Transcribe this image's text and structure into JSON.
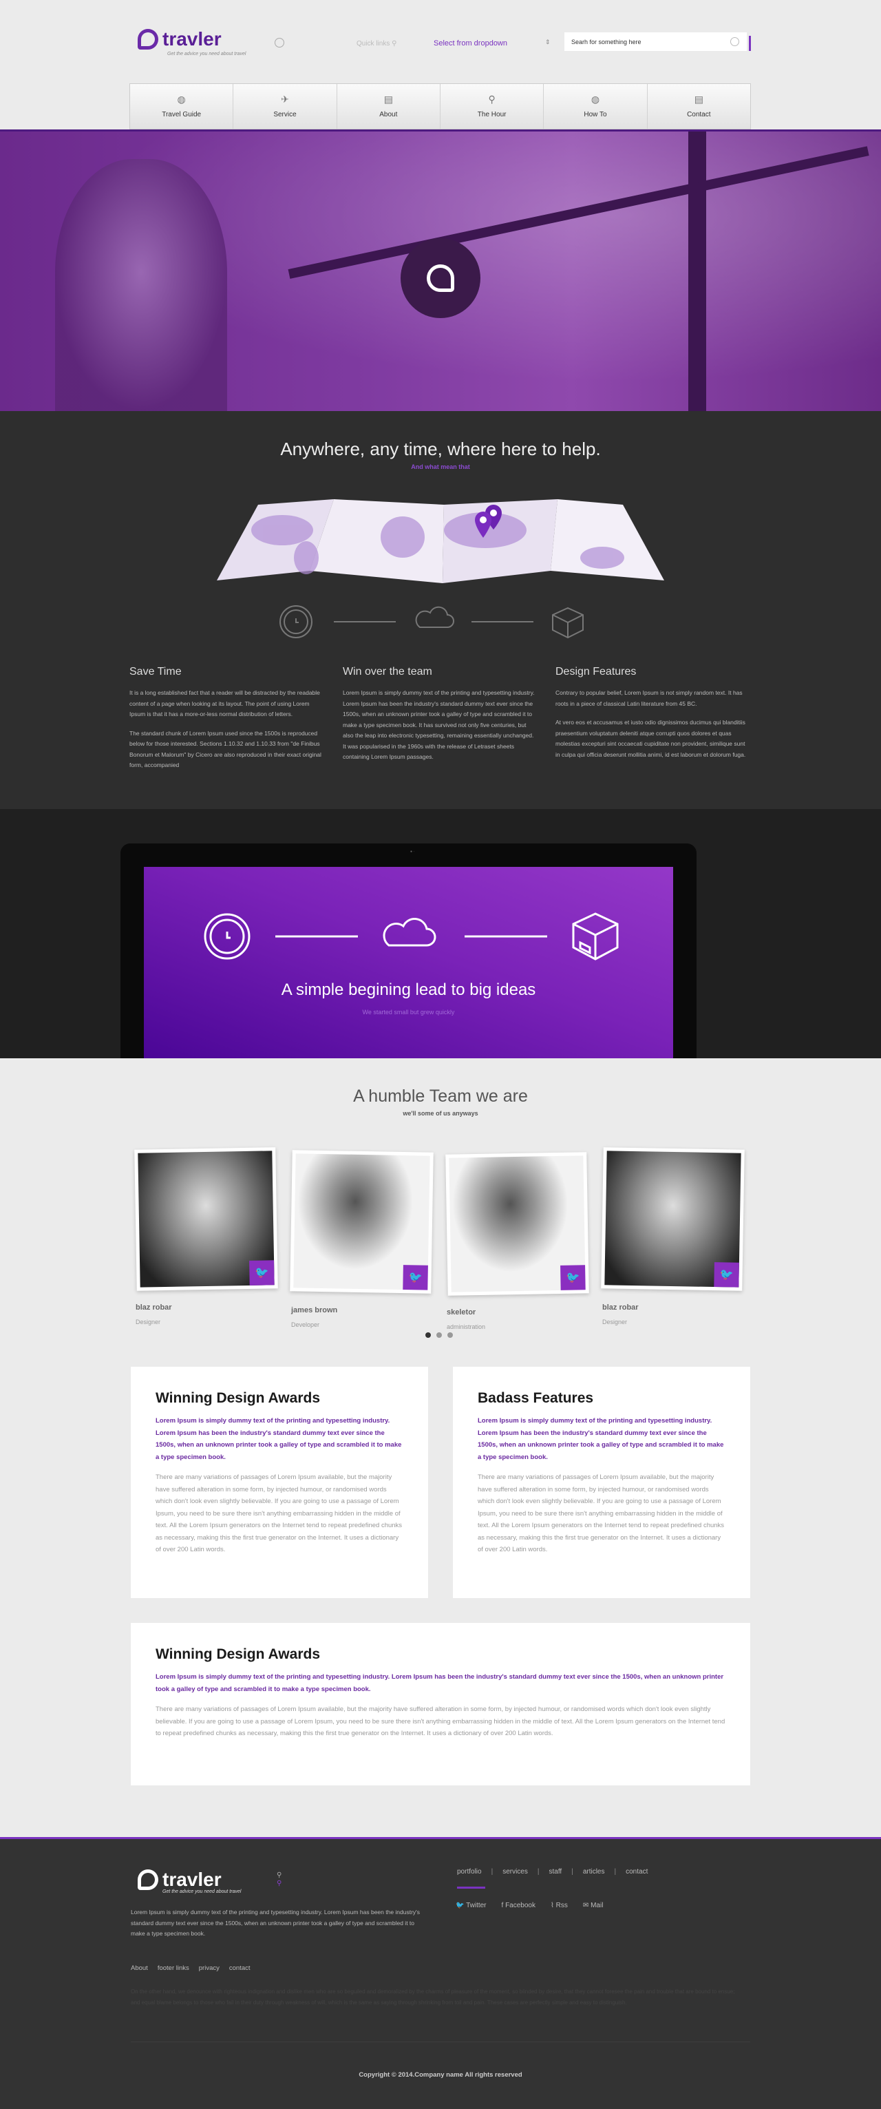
{
  "header": {
    "logo_text": "travler",
    "tagline": "Get the advice you need about travel",
    "quick_links": "Quick links",
    "dropdown_selected": "Select from dropdown",
    "search_placeholder": "Searh for something here"
  },
  "nav": [
    {
      "label": "Travel Guide",
      "icon": "globe-icon"
    },
    {
      "label": "Service",
      "icon": "paper-plane-icon"
    },
    {
      "label": "About",
      "icon": "document-icon"
    },
    {
      "label": "The Hour",
      "icon": "map-pin-icon"
    },
    {
      "label": "How To",
      "icon": "globe-icon"
    },
    {
      "label": "Contact",
      "icon": "document-icon"
    }
  ],
  "colors": {
    "accent": "#7a33c0",
    "dark": "#2e2e2e",
    "light": "#ebebeb"
  },
  "help": {
    "title": "Anywhere, any time, where here to help.",
    "subtitle": "And what mean that",
    "columns": [
      {
        "heading": "Save Time",
        "paragraphs": [
          "It is a long established fact that a reader will be distracted by the readable content of a page when looking at its layout. The point of using Lorem Ipsum is that it has a more-or-less normal distribution of letters.",
          "The standard chunk of Lorem Ipsum used since the 1500s is reproduced below for those interested. Sections 1.10.32 and 1.10.33 from \"de Finibus Bonorum et Malorum\" by Cicero are also reproduced in their exact original form, accompanied"
        ]
      },
      {
        "heading": "Win over the team",
        "paragraphs": [
          "Lorem Ipsum is simply dummy text of the printing and typesetting industry. Lorem Ipsum has been the industry's standard dummy text ever since the 1500s, when an unknown printer took a galley of type and scrambled it to make a type specimen book. It has survived not only five centuries, but also the leap into electronic typesetting, remaining essentially unchanged. It was popularised in the 1960s with the release of Letraset sheets containing Lorem Ipsum passages."
        ]
      },
      {
        "heading": "Design Features",
        "paragraphs": [
          "Contrary to popular belief, Lorem Ipsum is not simply random text. It has roots in a piece of classical Latin literature from 45 BC.",
          "At vero eos et accusamus et iusto odio dignissimos ducimus qui blanditiis praesentium voluptatum deleniti atque corrupti quos dolores et quas molestias excepturi sint occaecati cupiditate non provident, similique sunt in culpa qui officia deserunt mollitia animi, id est laborum et dolorum fuga."
        ]
      }
    ]
  },
  "ideas": {
    "title": "A simple begining lead to big ideas",
    "subtitle": "We started small but grew quickly"
  },
  "team": {
    "title": "A humble Team we are",
    "subtitle": "we'll some of us anyways",
    "members": [
      {
        "name": "blaz robar",
        "role": "Designer"
      },
      {
        "name": "james brown",
        "role": "Developer"
      },
      {
        "name": "skeletor",
        "role": "administration"
      },
      {
        "name": "blaz robar",
        "role": "Designer"
      }
    ],
    "active_page": 1,
    "pages": 3
  },
  "cards": [
    {
      "title": "Winning Design Awards",
      "lead": "Lorem Ipsum is simply dummy text of the printing and typesetting industry. Lorem Ipsum has been the industry's standard dummy text ever since the 1500s, when an unknown printer took a galley of type and scrambled it to make a type specimen book.",
      "body": "There are many variations of passages of Lorem Ipsum available, but the majority have suffered alteration in some form, by injected humour, or randomised words which don't look even slightly believable. If you are going to use a passage of Lorem Ipsum, you need to be sure there isn't anything embarrassing hidden in the middle of text. All the Lorem Ipsum generators on the Internet tend to repeat predefined chunks as necessary, making this the first true generator on the Internet. It uses a dictionary of over 200 Latin words."
    },
    {
      "title": "Badass Features",
      "lead": "Lorem Ipsum is simply dummy text of the printing and typesetting industry. Lorem Ipsum has been the industry's standard dummy text ever since the 1500s, when an unknown printer took a galley of type and scrambled it to make a type specimen book.",
      "body": "There are many variations of passages of Lorem Ipsum available, but the majority have suffered alteration in some form, by injected humour, or randomised words which don't look even slightly believable. If you are going to use a passage of Lorem Ipsum, you need to be sure there isn't anything embarrassing hidden in the middle of text. All the Lorem Ipsum generators on the Internet tend to repeat predefined chunks as necessary, making this the first true generator on the Internet. It uses a dictionary of over 200 Latin words."
    },
    {
      "title": "Winning Design Awards",
      "lead": "Lorem Ipsum is simply dummy text of the printing and typesetting industry. Lorem Ipsum has been the industry's standard dummy text ever since the 1500s, when an unknown printer took a galley of type and scrambled it to make a type specimen book.",
      "body": "There are many variations of passages of Lorem Ipsum available, but the majority have suffered alteration in some form, by injected humour, or randomised words which don't look even slightly believable. If you are going to use a passage of Lorem Ipsum, you need to be sure there isn't anything embarrassing hidden in the middle of text. All the Lorem Ipsum generators on the Internet tend to repeat predefined chunks as necessary, making this the first true generator on the Internet. It uses a dictionary of over 200 Latin words."
    }
  ],
  "footer": {
    "logo_text": "travler",
    "tagline": "Get the advice you need about travel",
    "text": "Lorem Ipsum is simply dummy text of the printing and typesetting industry. Lorem Ipsum has been the industry's standard dummy text ever since the 1500s, when an unknown printer took a galley of type and scrambled it to make a type specimen book.",
    "links": [
      "portfolio",
      "services",
      "staff",
      "articles",
      "contact"
    ],
    "social": [
      {
        "label": "Twitter",
        "icon": "twitter-icon"
      },
      {
        "label": "Facebook",
        "icon": "facebook-icon"
      },
      {
        "label": "Rss",
        "icon": "rss-icon"
      },
      {
        "label": "Mail",
        "icon": "mail-icon"
      }
    ],
    "bottom_links": [
      "About",
      "footer links",
      "privacy",
      "contact"
    ],
    "faint_text": "On the other hand, we denounce with righteous indignation and dislike men who are so beguiled and demoralized by the charms of pleasure of the moment, so blinded by desire, that they cannot foresee the pain and trouble that are bound to ensue; and equal blame belongs to those who fail in their duty through weakness of will, which is the same as saying through shrinking from toil and pain. These cases are perfectly simple and easy to distinguish.",
    "copyright": "Copyright © 2014.Company name All rights reserved"
  }
}
